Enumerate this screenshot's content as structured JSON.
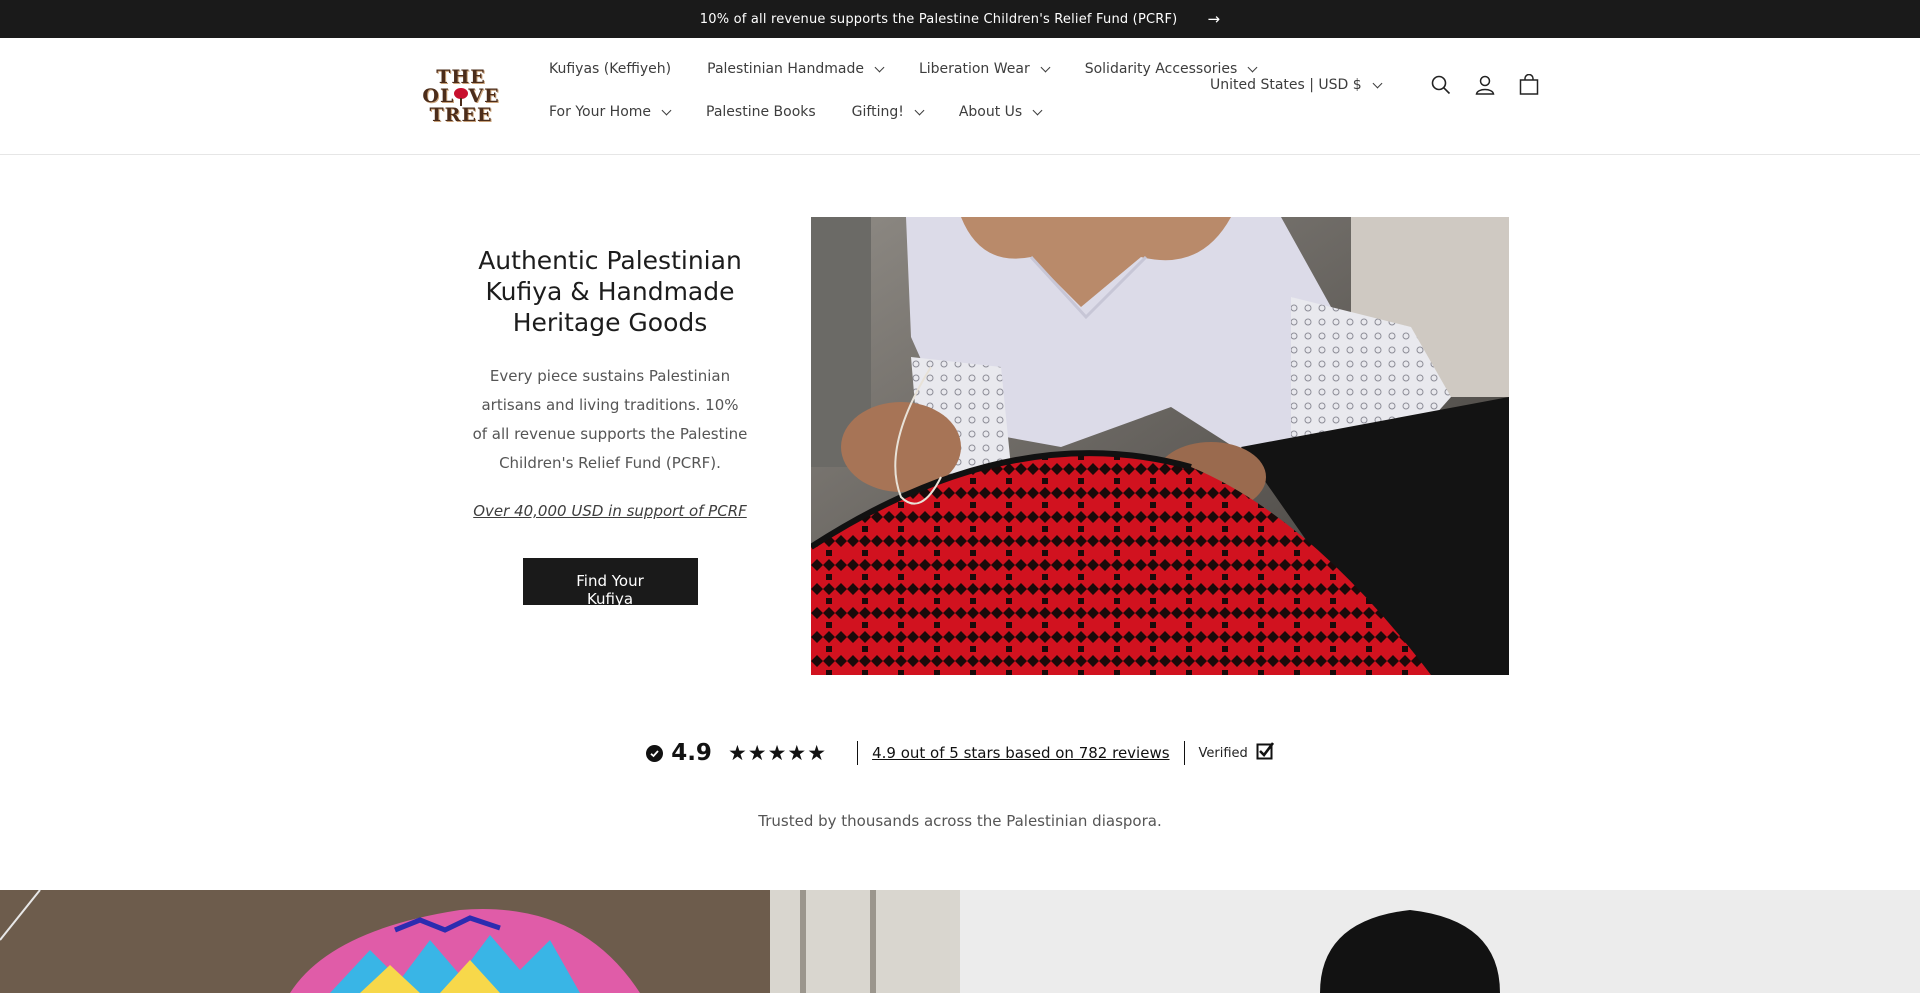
{
  "announcement": {
    "text": "10% of all revenue supports the Palestine Children's Relief Fund (PCRF)",
    "arrow": "→"
  },
  "header": {
    "logo": {
      "line1": "THE",
      "line2a": "OL",
      "line2b": "VE",
      "line3": "TREE"
    },
    "nav_row1": [
      {
        "label": "Kufiyas (Keffiyeh)",
        "dropdown": false
      },
      {
        "label": "Palestinian Handmade",
        "dropdown": true
      },
      {
        "label": "Liberation Wear",
        "dropdown": true
      },
      {
        "label": "Solidarity Accessories",
        "dropdown": true
      }
    ],
    "nav_row2": [
      {
        "label": "For Your Home",
        "dropdown": true
      },
      {
        "label": "Palestine Books",
        "dropdown": false
      },
      {
        "label": "Gifting!",
        "dropdown": true
      },
      {
        "label": "About Us",
        "dropdown": true
      }
    ],
    "country_selector": "United States | USD $",
    "icons": [
      "search-icon",
      "account-icon",
      "cart-icon"
    ]
  },
  "hero": {
    "title": "Authentic Palestinian Kufiya & Handmade Heritage Goods",
    "description": "Every piece sustains Palestinian artisans and living traditions. 10% of all revenue supports the Palestine Children's Relief Fund (PCRF).",
    "link": "Over 40,000 USD in support of PCRF",
    "button": "Find Your Kufiya"
  },
  "reviews": {
    "rating": "4.9",
    "stars": 5,
    "summary": "4.9 out of 5 stars based on 782 reviews",
    "verified": "Verified"
  },
  "trusted_text": "Trusted by thousands across the Palestinian diaspora.",
  "colors": {
    "announcement_bg": "#1a1a1a",
    "button_bg": "#1a1a1a",
    "embroidery_red": "#c8102e"
  }
}
